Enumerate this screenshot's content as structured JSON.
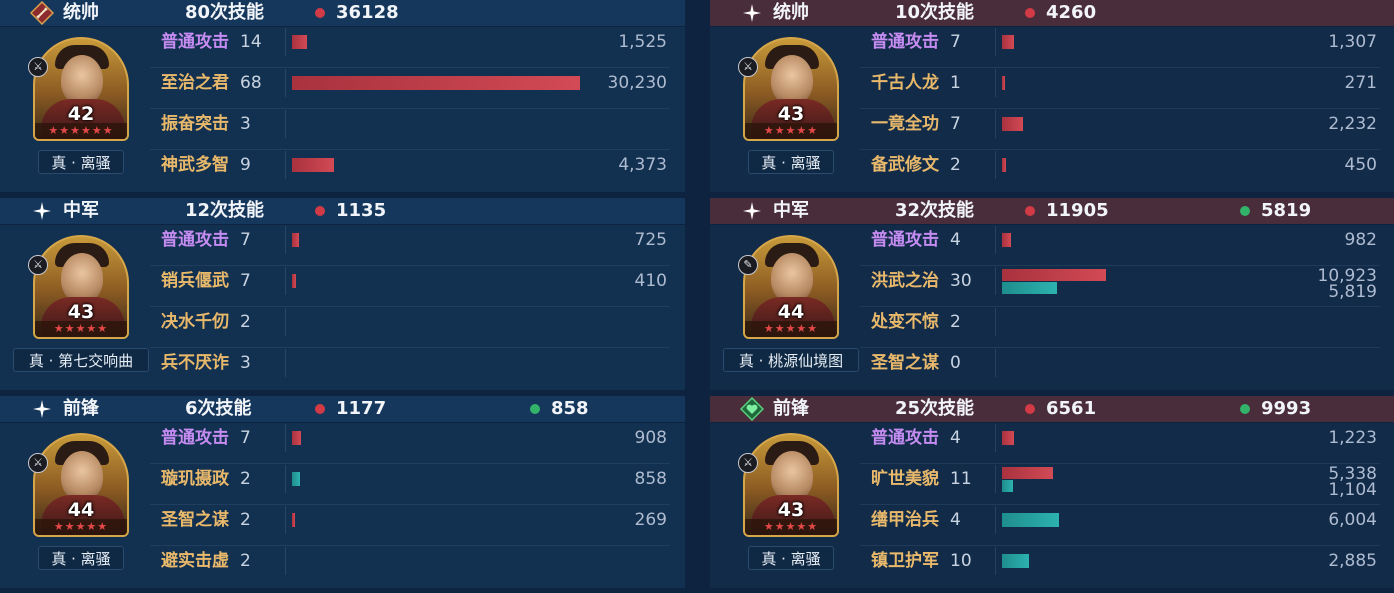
{
  "left": [
    {
      "role": "统帅",
      "role_icon": "sword-badge-icon",
      "count_label": "80次技能",
      "red_total": "36128",
      "green_total": "",
      "hero": {
        "level": "42",
        "stars": "★★★★★★",
        "title": "真 · 离骚",
        "tag": "sword-tag-icon"
      },
      "skills": [
        {
          "name": "普通攻击",
          "count": "14",
          "kind": "basic",
          "red": 1525,
          "green": null,
          "red_text": "1,525",
          "green_text": ""
        },
        {
          "name": "至治之君",
          "count": "68",
          "kind": "gold",
          "red": 30230,
          "green": null,
          "red_text": "30,230",
          "green_text": ""
        },
        {
          "name": "振奋突击",
          "count": "3",
          "kind": "gold",
          "red": null,
          "green": null,
          "red_text": "",
          "green_text": ""
        },
        {
          "name": "神武多智",
          "count": "9",
          "kind": "gold",
          "red": 4373,
          "green": null,
          "red_text": "4,373",
          "green_text": ""
        }
      ]
    },
    {
      "role": "中军",
      "role_icon": "sparkle-icon",
      "count_label": "12次技能",
      "red_total": "1135",
      "green_total": "",
      "hero": {
        "level": "43",
        "stars": "★★★★★",
        "title": "真 · 第七交响曲",
        "tag": "sword-tag-icon"
      },
      "skills": [
        {
          "name": "普通攻击",
          "count": "7",
          "kind": "basic",
          "red": 725,
          "green": null,
          "red_text": "725",
          "green_text": ""
        },
        {
          "name": "销兵偃武",
          "count": "7",
          "kind": "gold",
          "red": 410,
          "green": null,
          "red_text": "410",
          "green_text": ""
        },
        {
          "name": "决水千仞",
          "count": "2",
          "kind": "gold",
          "red": null,
          "green": null,
          "red_text": "",
          "green_text": ""
        },
        {
          "name": "兵不厌诈",
          "count": "3",
          "kind": "gold",
          "red": null,
          "green": null,
          "red_text": "",
          "green_text": ""
        }
      ]
    },
    {
      "role": "前锋",
      "role_icon": "sparkle-icon",
      "count_label": "6次技能",
      "red_total": "1177",
      "green_total": "858",
      "hero": {
        "level": "44",
        "stars": "★★★★★",
        "title": "真 · 离骚",
        "tag": "sword-tag-icon"
      },
      "skills": [
        {
          "name": "普通攻击",
          "count": "7",
          "kind": "basic",
          "red": 908,
          "green": null,
          "red_text": "908",
          "green_text": ""
        },
        {
          "name": "璇玑摄政",
          "count": "2",
          "kind": "gold",
          "red": null,
          "green": 858,
          "red_text": "",
          "green_text": "858"
        },
        {
          "name": "圣智之谋",
          "count": "2",
          "kind": "gold",
          "red": 269,
          "green": null,
          "red_text": "269",
          "green_text": ""
        },
        {
          "name": "避实击虚",
          "count": "2",
          "kind": "gold",
          "red": null,
          "green": null,
          "red_text": "",
          "green_text": ""
        }
      ]
    }
  ],
  "right": [
    {
      "role": "统帅",
      "role_icon": "sparkle-icon",
      "count_label": "10次技能",
      "red_total": "4260",
      "green_total": "",
      "hero": {
        "level": "43",
        "stars": "★★★★★",
        "title": "真 · 离骚",
        "tag": "sword-tag-icon"
      },
      "skills": [
        {
          "name": "普通攻击",
          "count": "7",
          "kind": "basic",
          "red": 1307,
          "green": null,
          "red_text": "1,307",
          "green_text": ""
        },
        {
          "name": "千古人龙",
          "count": "1",
          "kind": "gold",
          "red": 271,
          "green": null,
          "red_text": "271",
          "green_text": ""
        },
        {
          "name": "一竟全功",
          "count": "7",
          "kind": "gold",
          "red": 2232,
          "green": null,
          "red_text": "2,232",
          "green_text": ""
        },
        {
          "name": "备武修文",
          "count": "2",
          "kind": "gold",
          "red": 450,
          "green": null,
          "red_text": "450",
          "green_text": ""
        }
      ]
    },
    {
      "role": "中军",
      "role_icon": "sparkle-icon",
      "count_label": "32次技能",
      "red_total": "11905",
      "green_total": "5819",
      "hero": {
        "level": "44",
        "stars": "★★★★★",
        "title": "真 · 桃源仙境图",
        "tag": "feather-tag-icon"
      },
      "skills": [
        {
          "name": "普通攻击",
          "count": "4",
          "kind": "basic",
          "red": 982,
          "green": null,
          "red_text": "982",
          "green_text": ""
        },
        {
          "name": "洪武之治",
          "count": "30",
          "kind": "gold",
          "red": 10923,
          "green": 5819,
          "red_text": "10,923",
          "green_text": "5,819"
        },
        {
          "name": "处变不惊",
          "count": "2",
          "kind": "gold",
          "red": null,
          "green": null,
          "red_text": "",
          "green_text": ""
        },
        {
          "name": "圣智之谋",
          "count": "0",
          "kind": "gold",
          "red": null,
          "green": null,
          "red_text": "",
          "green_text": ""
        }
      ]
    },
    {
      "role": "前锋",
      "role_icon": "heart-badge-icon",
      "count_label": "25次技能",
      "red_total": "6561",
      "green_total": "9993",
      "hero": {
        "level": "43",
        "stars": "★★★★★",
        "title": "真 · 离骚",
        "tag": "sword-tag-icon"
      },
      "skills": [
        {
          "name": "普通攻击",
          "count": "4",
          "kind": "basic",
          "red": 1223,
          "green": null,
          "red_text": "1,223",
          "green_text": ""
        },
        {
          "name": "旷世美貌",
          "count": "11",
          "kind": "gold",
          "red": 5338,
          "green": 1104,
          "red_text": "5,338",
          "green_text": "1,104"
        },
        {
          "name": "缮甲治兵",
          "count": "4",
          "kind": "gold",
          "red": null,
          "green": 6004,
          "red_text": "",
          "green_text": "6,004"
        },
        {
          "name": "镇卫护军",
          "count": "10",
          "kind": "gold",
          "red": null,
          "green": 2885,
          "red_text": "",
          "green_text": "2,885"
        }
      ]
    }
  ],
  "colors": {
    "damage": "#d24a55",
    "heal": "#2cb2b0",
    "basic_skill": "#c58cf2",
    "skill": "#e9b96b"
  },
  "max_value": 30230
}
